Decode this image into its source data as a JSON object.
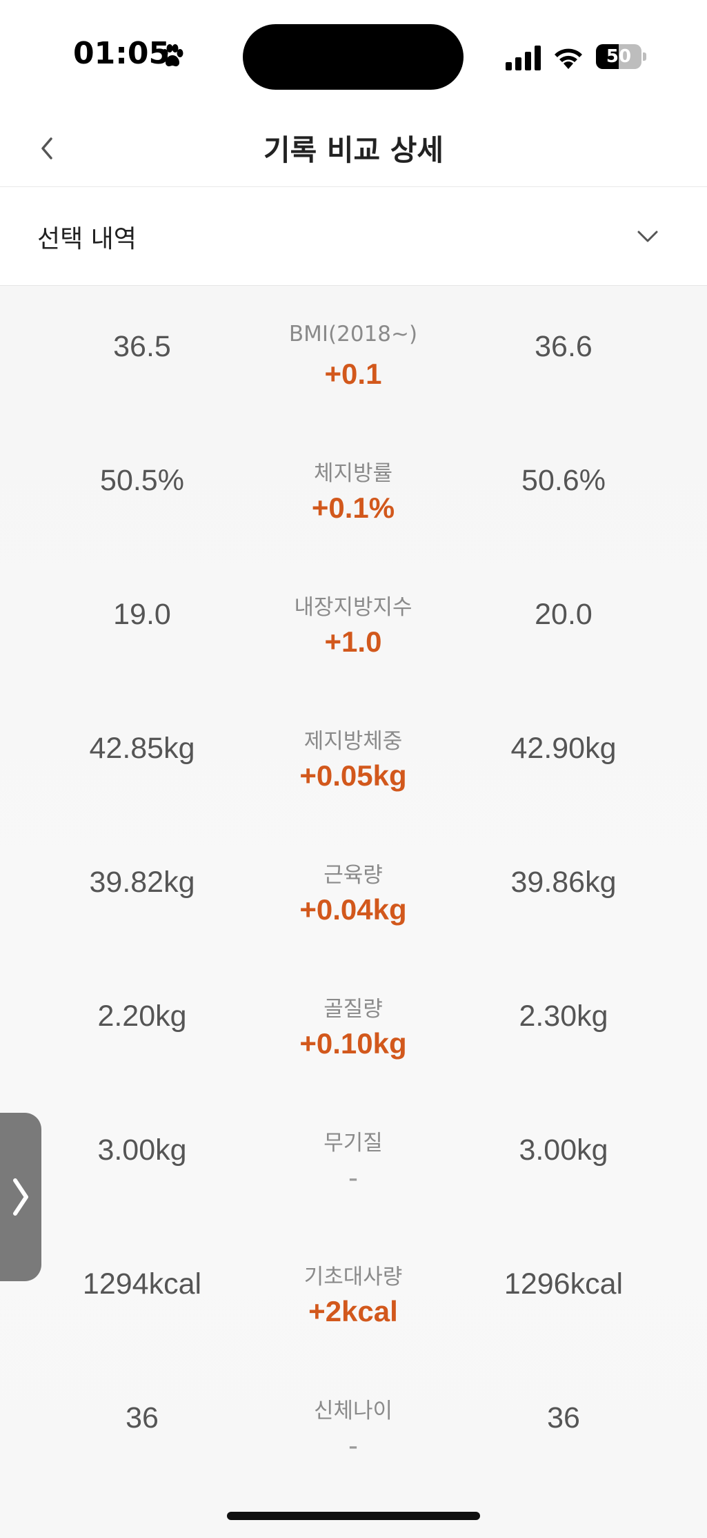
{
  "status_bar": {
    "time": "01:05",
    "battery": "50",
    "battery_level": 0.5,
    "icons": [
      "paw-icon",
      "signal-icon",
      "wifi-icon",
      "battery-icon"
    ]
  },
  "nav": {
    "title": "기록 비교 상세",
    "back_icon": "chevron-left-icon"
  },
  "selection": {
    "label": "선택 내역",
    "toggle_icon": "chevron-down-icon"
  },
  "rows": [
    {
      "name": "BMI(2018~)",
      "left": "36.5",
      "right": "36.6",
      "diff": "+0.1"
    },
    {
      "name": "체지방률",
      "left": "50.5%",
      "right": "50.6%",
      "diff": "+0.1%"
    },
    {
      "name": "내장지방지수",
      "left": "19.0",
      "right": "20.0",
      "diff": "+1.0"
    },
    {
      "name": "제지방체중",
      "left": "42.85kg",
      "right": "42.90kg",
      "diff": "+0.05kg"
    },
    {
      "name": "근육량",
      "left": "39.82kg",
      "right": "39.86kg",
      "diff": "+0.04kg"
    },
    {
      "name": "골질량",
      "left": "2.20kg",
      "right": "2.30kg",
      "diff": "+0.10kg"
    },
    {
      "name": "무기질",
      "left": "3.00kg",
      "right": "3.00kg",
      "diff": "-"
    },
    {
      "name": "기초대사량",
      "left": "1294kcal",
      "right": "1296kcal",
      "diff": "+2kcal"
    },
    {
      "name": "신체나이",
      "left": "36",
      "right": "36",
      "diff": "-"
    }
  ],
  "drawer": {
    "icon": "chevron-right-icon"
  },
  "colors": {
    "accent": "#d2581c",
    "neutral": "#9a9a9a"
  }
}
